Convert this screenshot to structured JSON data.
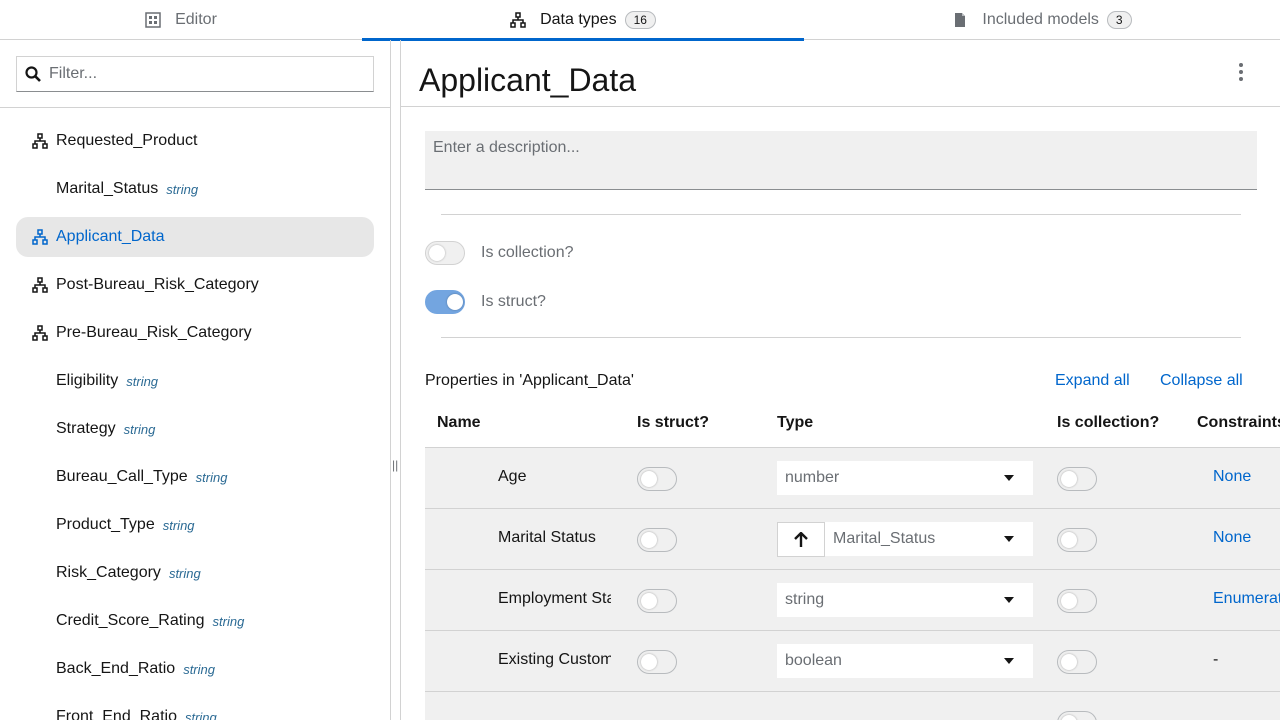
{
  "tabs": [
    {
      "label": "Editor",
      "icon": "editor-icon"
    },
    {
      "label": "Data types",
      "icon": "data-types-icon",
      "count": "16"
    },
    {
      "label": "Included models",
      "icon": "file-icon",
      "count": "3"
    }
  ],
  "sidebar": {
    "filter_placeholder": "Filter...",
    "items": [
      {
        "label": "Requested_Product",
        "icon": "structure-icon"
      },
      {
        "label": "Marital_Status",
        "type": "string"
      },
      {
        "label": "Applicant_Data",
        "icon": "structure-icon",
        "selected": true
      },
      {
        "label": "Post-Bureau_Risk_Category",
        "icon": "structure-icon"
      },
      {
        "label": "Pre-Bureau_Risk_Category",
        "icon": "structure-icon"
      },
      {
        "label": "Eligibility",
        "type": "string"
      },
      {
        "label": "Strategy",
        "type": "string"
      },
      {
        "label": "Bureau_Call_Type",
        "type": "string"
      },
      {
        "label": "Product_Type",
        "type": "string"
      },
      {
        "label": "Risk_Category",
        "type": "string"
      },
      {
        "label": "Credit_Score_Rating",
        "type": "string"
      },
      {
        "label": "Back_End_Ratio",
        "type": "string"
      },
      {
        "label": "Front_End_Ratio",
        "type": "string"
      }
    ]
  },
  "main": {
    "title": "Applicant_Data",
    "description_placeholder": "Enter a description...",
    "is_collection_label": "Is collection?",
    "is_struct_label": "Is struct?",
    "properties_title": "Properties in 'Applicant_Data'",
    "expand_all": "Expand all",
    "collapse_all": "Collapse all",
    "columns": {
      "name": "Name",
      "is_struct": "Is struct?",
      "type": "Type",
      "is_collection": "Is collection?",
      "constraints": "Constraints"
    },
    "rows": [
      {
        "name": "Age",
        "type": "number",
        "constraint": "None"
      },
      {
        "name": "Marital Status",
        "type": "Marital_Status",
        "constraint": "None"
      },
      {
        "name": "Employment Sta",
        "type": "string",
        "constraint": "Enumerat"
      },
      {
        "name": "Existing Custom",
        "type": "boolean",
        "constraint": "-"
      }
    ]
  },
  "colors": {
    "accent": "#0066cc",
    "selected_bg": "#e7e7e7",
    "row_bg": "#f0f0f0"
  }
}
